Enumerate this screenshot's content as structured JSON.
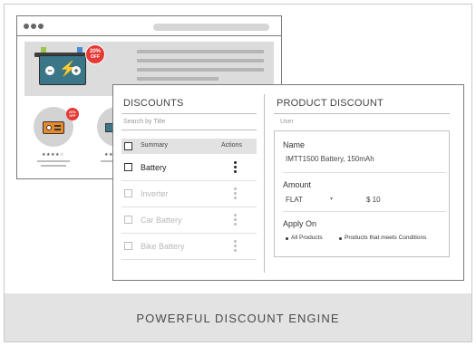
{
  "hero": {
    "badge_line1": "20%",
    "badge_line2": "OFF",
    "battery_minus": "−",
    "battery_plus": "+"
  },
  "product_badge": {
    "line1": "20%",
    "line2": "OFF"
  },
  "discounts": {
    "title": "DISCOUNTS",
    "search_placeholder": "Search by Title",
    "columns": [
      "Summary",
      "Actions"
    ],
    "rows": [
      {
        "label": "Battery",
        "active": true
      },
      {
        "label": "Inverter",
        "active": false
      },
      {
        "label": "Car Battery",
        "active": false
      },
      {
        "label": "Bike Battery",
        "active": false
      }
    ]
  },
  "product_discount": {
    "title": "PRODUCT DISCOUNT",
    "user_label": "User",
    "name_label": "Name",
    "name_value": "IMTT1500 Battery, 150mAh",
    "amount_label": "Amount",
    "amount_type": "FLAT",
    "amount_value": "$ 10",
    "apply_label": "Apply On",
    "apply_options": [
      "All Products",
      "Products that meets Conditions"
    ]
  },
  "footer": {
    "caption": "POWERFUL DISCOUNT ENGINE"
  },
  "colors": {
    "badge": "#e53935",
    "battery": "#3a7688",
    "bolt": "#f2a31b",
    "footer_bg": "#e3e3e3"
  }
}
